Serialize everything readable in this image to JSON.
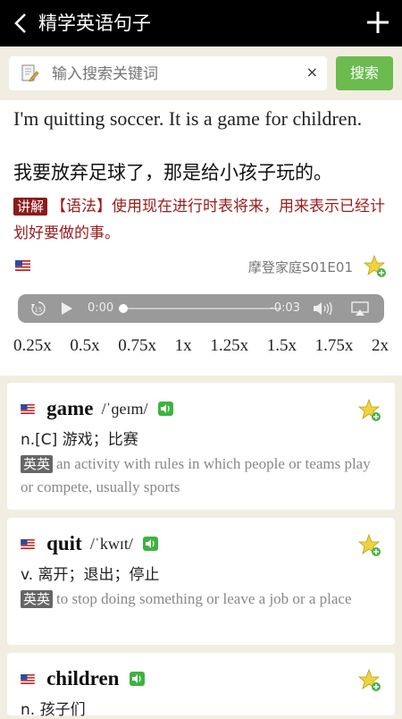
{
  "header": {
    "title": "精学英语句子"
  },
  "search": {
    "placeholder": "输入搜索关键词",
    "clear": "×",
    "button": "搜索"
  },
  "sentence": {
    "english": "I'm quitting soccer. It is a game for children.",
    "chinese": "我要放弃足球了，那是给小孩子玩的。",
    "note_tag": "讲解",
    "note_text": "【语法】使用现在进行时表将来，用来表示已经计划好要做的事。",
    "source": "摩登家庭S01E01"
  },
  "player": {
    "elapsed": "0:00",
    "remaining": "-0:03",
    "rewind": "15",
    "progress": 0
  },
  "speeds": [
    "0.25x",
    "0.5x",
    "0.75x",
    "1x",
    "1.25x",
    "1.5x",
    "1.75x",
    "2x"
  ],
  "words": [
    {
      "word": "game",
      "phonetic": "/ˈɡeɪm/",
      "pos": "n.[C] 游戏；比赛",
      "ee": "英英",
      "definition": "an activity with rules in which people or teams play or compete, usually sports"
    },
    {
      "word": "quit",
      "phonetic": "/ˈkwɪt/",
      "pos": "v. 离开；退出；停止",
      "ee": "英英",
      "definition": "to stop doing something or leave a job or a place"
    },
    {
      "word": "children",
      "phonetic": "",
      "pos": "n. 孩子们",
      "ee": "",
      "definition": ""
    }
  ],
  "colors": {
    "accent": "#6bbb4f",
    "note": "#9b1b1b",
    "header": "#000000",
    "background": "#f1eee1"
  }
}
